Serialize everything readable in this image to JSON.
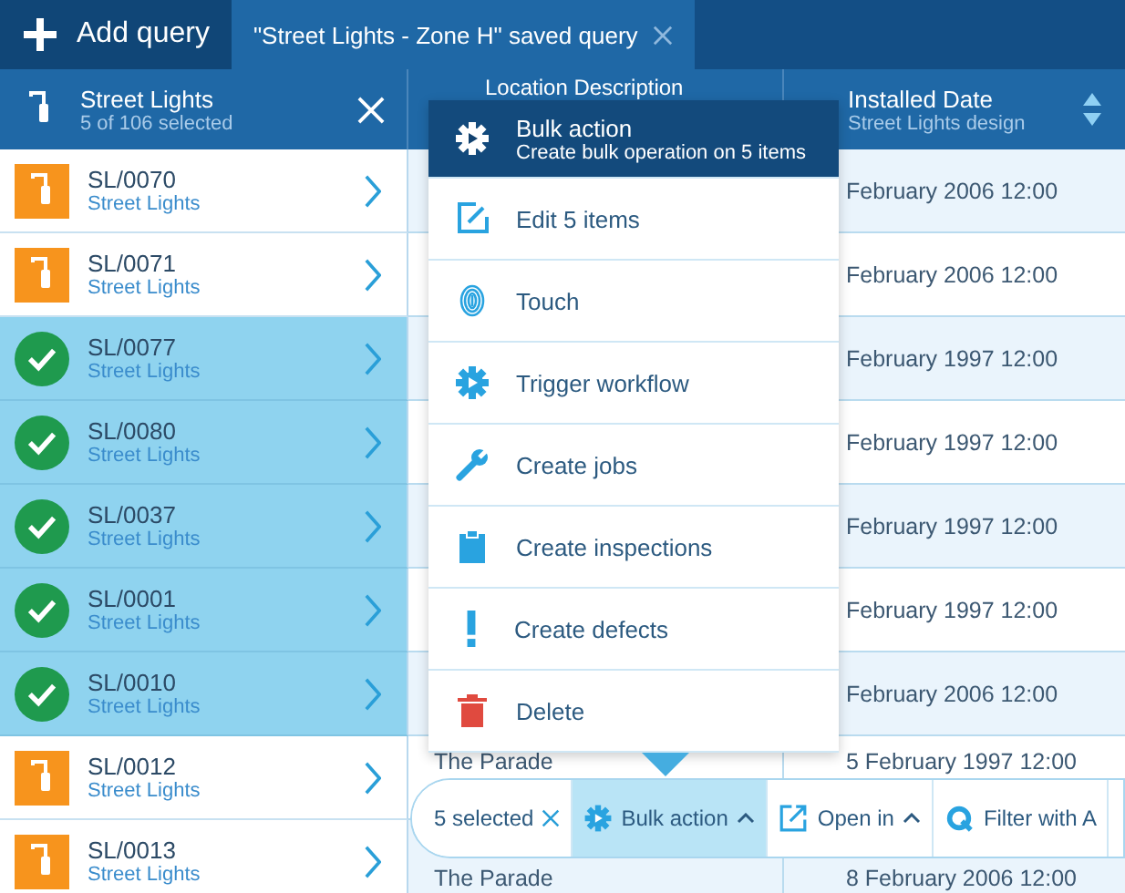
{
  "tabs": [
    {
      "kind": "add",
      "label": "Add query",
      "selected": false
    },
    {
      "kind": "query",
      "label": "\"Street Lights - Zone H\" saved query",
      "selected": true
    }
  ],
  "list_header": {
    "title": "Street Lights",
    "subtitle": "5 of 106 selected"
  },
  "columns": [
    {
      "title": "Location Description"
    },
    {
      "title": "Installed Date",
      "subtitle": "Street Lights design"
    }
  ],
  "rows": [
    {
      "id": "SL/0070",
      "type": "Street Lights",
      "selected": false,
      "date": "February 2006 12:00"
    },
    {
      "id": "SL/0071",
      "type": "Street Lights",
      "selected": false,
      "date": "February 2006 12:00"
    },
    {
      "id": "SL/0077",
      "type": "Street Lights",
      "selected": true,
      "date": "February 1997 12:00"
    },
    {
      "id": "SL/0080",
      "type": "Street Lights",
      "selected": true,
      "date": "February 1997 12:00"
    },
    {
      "id": "SL/0037",
      "type": "Street Lights",
      "selected": true,
      "date": "February 1997 12:00"
    },
    {
      "id": "SL/0001",
      "type": "Street Lights",
      "selected": true,
      "date": "February 1997 12:00"
    },
    {
      "id": "SL/0010",
      "type": "Street Lights",
      "selected": true,
      "date": "February 2006 12:00"
    },
    {
      "id": "SL/0012",
      "type": "Street Lights",
      "selected": false,
      "location": "The Parade",
      "date": "5 February 1997 12:00"
    },
    {
      "id": "SL/0013",
      "type": "Street Lights",
      "selected": false,
      "location": "The Parade",
      "date": "8 February 2006 12:00"
    }
  ],
  "menu": {
    "items": [
      {
        "kind": "gear",
        "label": "Bulk action",
        "description": "Create bulk operation on 5 items",
        "highlighted": true
      },
      {
        "kind": "edit",
        "label": "Edit 5 items",
        "highlighted": false
      },
      {
        "kind": "fingerprint",
        "label": "Touch",
        "highlighted": false
      },
      {
        "kind": "gear",
        "label": "Trigger workflow",
        "highlighted": false
      },
      {
        "kind": "wrench",
        "label": "Create jobs",
        "highlighted": false
      },
      {
        "kind": "clipboard",
        "label": "Create inspections",
        "highlighted": false
      },
      {
        "kind": "exclamation",
        "label": "Create defects",
        "highlighted": false
      },
      {
        "kind": "trash",
        "label": "Delete",
        "highlighted": false
      }
    ]
  },
  "toolbar": {
    "selection": "5 selected",
    "buttons": [
      {
        "kind": "gear",
        "label": "Bulk action",
        "dropdown": true,
        "selected": true
      },
      {
        "kind": "open",
        "label": "Open in",
        "dropdown": true,
        "selected": false
      },
      {
        "kind": "filter",
        "label": "Filter with A",
        "dropdown": false,
        "selected": false
      }
    ]
  }
}
